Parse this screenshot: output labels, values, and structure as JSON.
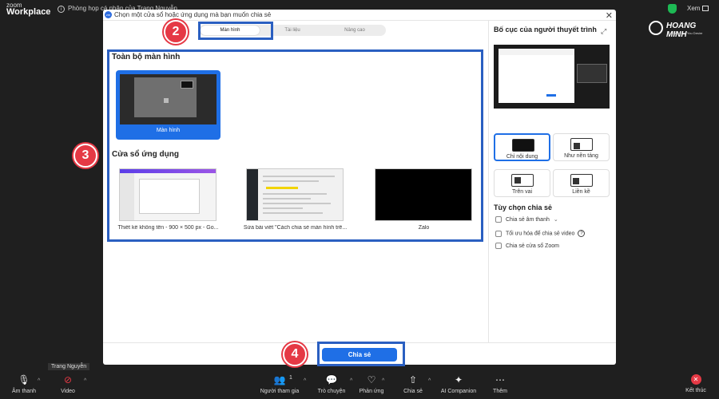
{
  "topbar": {
    "logo_line1": "zoom",
    "logo_line2": "Workplace",
    "meeting_info": "Phòng họp cá nhân của Trang Nguyễn",
    "view_label": "Xem"
  },
  "watermark": {
    "brand": "HOANG MINH",
    "tagline": "Everything You Desire"
  },
  "dialog": {
    "title": "Chọn một cửa sổ hoặc ứng dụng mà bạn muốn chia sẻ",
    "tabs": [
      {
        "label": "Màn hình"
      },
      {
        "label": "Tài liệu"
      },
      {
        "label": "Nâng cao"
      }
    ],
    "full_screen_heading": "Toàn bộ màn hình",
    "screen_label": "Màn hình",
    "app_windows_heading": "Cửa sổ ứng dụng",
    "apps": [
      {
        "label": "Thiết kế không tên - 900 × 500 px - Go..."
      },
      {
        "label": "Sửa bài viết \"Cách chia sẻ màn hình trê..."
      },
      {
        "label": "Zalo"
      }
    ],
    "share_button": "Chia sẻ"
  },
  "right_panel": {
    "title": "Bố cục của người thuyết trình",
    "layouts": [
      {
        "label": "Chỉ nội dung"
      },
      {
        "label": "Như nền tảng"
      },
      {
        "label": "Trên vai"
      },
      {
        "label": "Liền kề"
      }
    ],
    "options_heading": "Tùy chọn chia sẻ",
    "options": [
      {
        "label": "Chia sẻ âm thanh",
        "has_caret": true
      },
      {
        "label": "Tối ưu hóa để chia sẻ video",
        "has_help": true
      },
      {
        "label": "Chia sẻ cửa sổ Zoom"
      }
    ]
  },
  "annotations": {
    "step2": "2",
    "step3": "3",
    "step4": "4",
    "highlight_color": "#2a5fc1",
    "badge_color": "#e53945"
  },
  "participant_name": "Trang Nguyễn",
  "toolbar": {
    "audio": "Âm thanh",
    "video": "Video",
    "participants": "Người tham gia",
    "participants_count": "1",
    "chat": "Trò chuyện",
    "reactions": "Phản ứng",
    "share": "Chia sẻ",
    "ai_companion": "AI Companion",
    "more": "Thêm",
    "end": "Kết thúc"
  },
  "colors": {
    "accent": "#1f6fe6",
    "danger": "#e53945",
    "background": "#1f1f1f"
  }
}
